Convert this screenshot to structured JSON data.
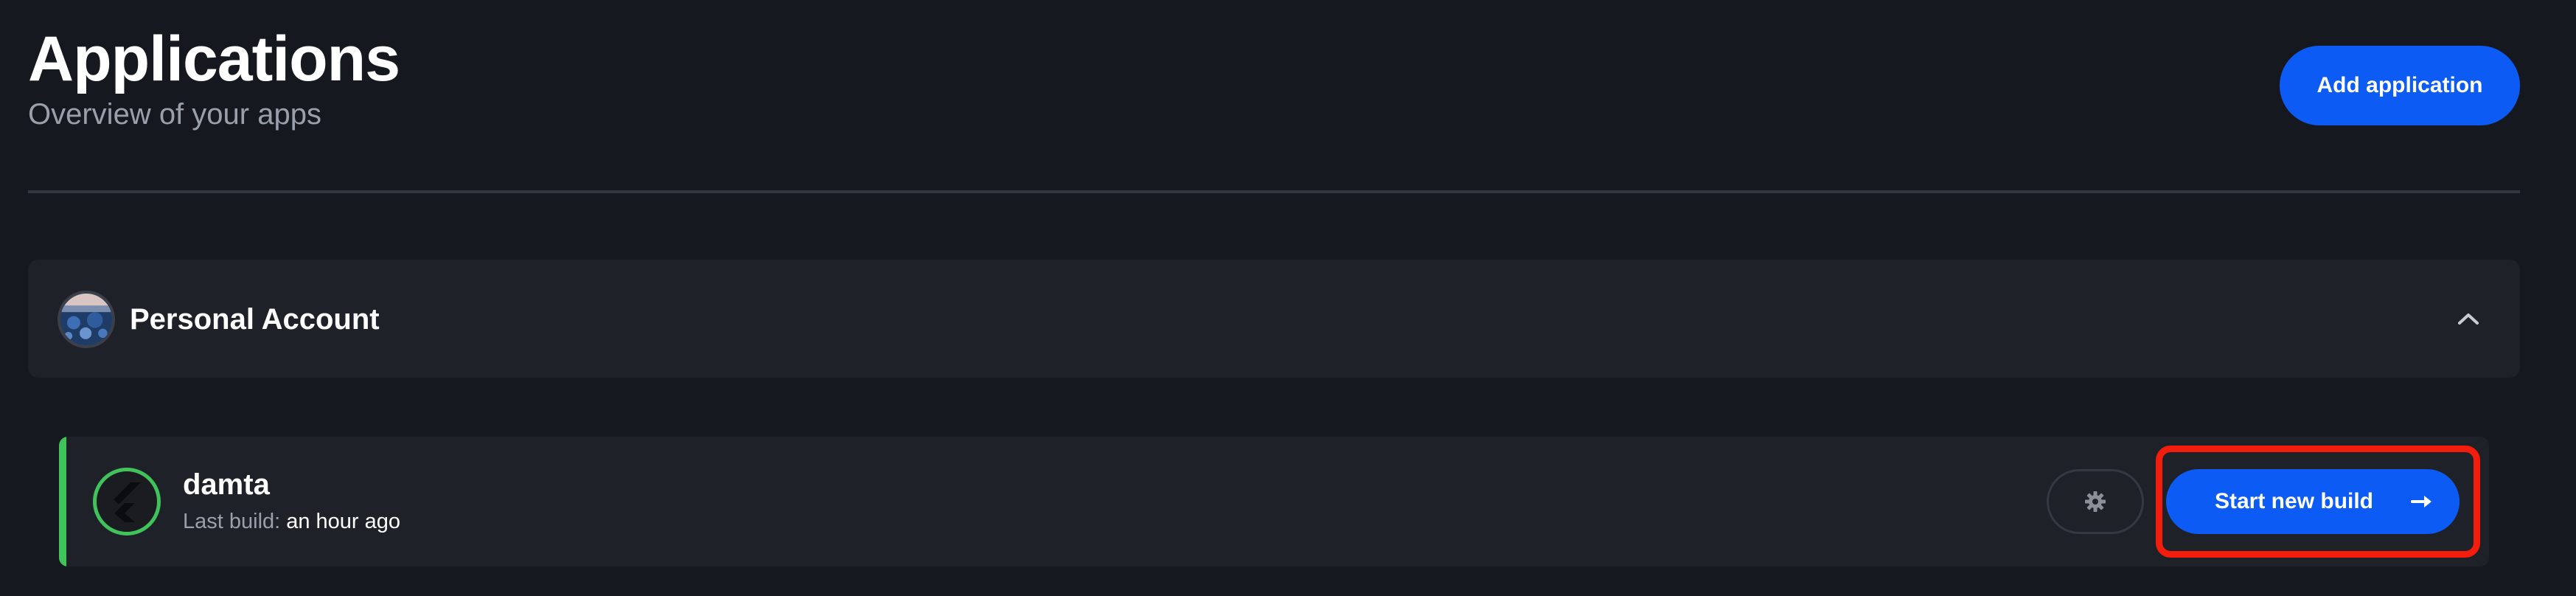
{
  "header": {
    "title": "Applications",
    "subtitle": "Overview of your apps",
    "add_button_label": "Add application"
  },
  "account": {
    "name": "Personal Account",
    "avatar_icon": "user-avatar",
    "collapse_icon": "chevron-up-icon",
    "expanded": true
  },
  "apps": [
    {
      "name": "damta",
      "icon": "flutter-logo-icon",
      "status_color": "#3fc35a",
      "last_build_label": "Last build:",
      "last_build_value": "an hour ago",
      "settings_icon": "gear-icon",
      "start_build_label": "Start new build",
      "start_build_icon": "arrow-right-icon"
    }
  ],
  "colors": {
    "background": "#16181f",
    "panel": "#1f2129",
    "accent": "#0d5bf5",
    "success": "#3fc35a",
    "highlight": "#f21d0d",
    "muted_text": "#9aa0ab"
  }
}
